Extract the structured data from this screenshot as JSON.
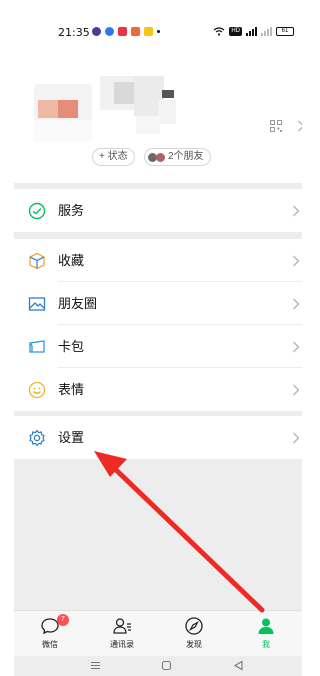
{
  "status_bar": {
    "time": "21:35",
    "battery": "61",
    "hd_label": "HD"
  },
  "profile": {
    "status_label": "+ 状态",
    "friends_label": "2个朋友"
  },
  "menu": {
    "services": "服务",
    "favorites": "收藏",
    "moments": "朋友圈",
    "cards": "卡包",
    "stickers": "表情",
    "settings": "设置"
  },
  "tabbar": {
    "chats": "微信",
    "chats_badge": "7",
    "contacts": "通讯录",
    "discover": "发现",
    "me": "我"
  },
  "colors": {
    "accent_green": "#07c160",
    "badge_red": "#fa5151",
    "arrow_red": "#ef2a25"
  },
  "icons": {
    "services": "services-check-icon",
    "favorites": "favorites-cube-icon",
    "moments": "moments-picture-icon",
    "cards": "card-wallet-icon",
    "stickers": "sticker-smile-icon",
    "settings": "settings-gear-icon"
  }
}
